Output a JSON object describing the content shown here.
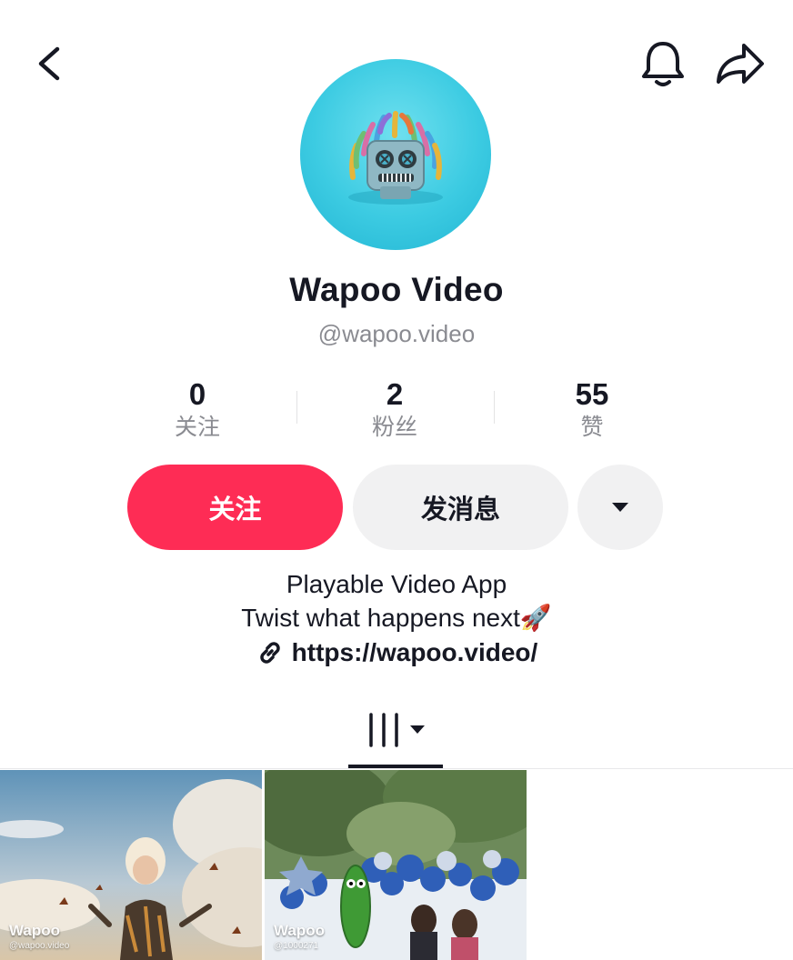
{
  "header": {
    "back_icon": "chevron-left-icon",
    "notification_icon": "bell-icon",
    "share_icon": "share-arrow-icon"
  },
  "profile": {
    "display_name": "Wapoo Video",
    "username": "@wapoo.video",
    "avatar": "robot-mascot-avatar"
  },
  "stats": [
    {
      "value": "0",
      "label": "关注"
    },
    {
      "value": "2",
      "label": "粉丝"
    },
    {
      "value": "55",
      "label": "赞"
    }
  ],
  "actions": {
    "follow_label": "关注",
    "message_label": "发消息",
    "more_icon": "caret-down-icon"
  },
  "bio": {
    "line1": "Playable Video App",
    "line2": "Twist what happens next",
    "line2_emoji": "🚀",
    "link_icon": "link-icon",
    "link": "https://wapoo.video/"
  },
  "tabs": {
    "grid_icon": "grid-icon",
    "grid_dropdown_icon": "caret-down-icon"
  },
  "videos": [
    {
      "watermark": "Wapoo",
      "watermark_sub": "@wapoo.video"
    },
    {
      "watermark": "Wapoo",
      "watermark_sub": "@1000271"
    }
  ],
  "colors": {
    "accent": "#fe2c55",
    "secondary_button": "#f1f1f2",
    "text_primary": "#161823",
    "text_secondary": "#8a8b91",
    "avatar_bg": "#3ccbe2"
  }
}
